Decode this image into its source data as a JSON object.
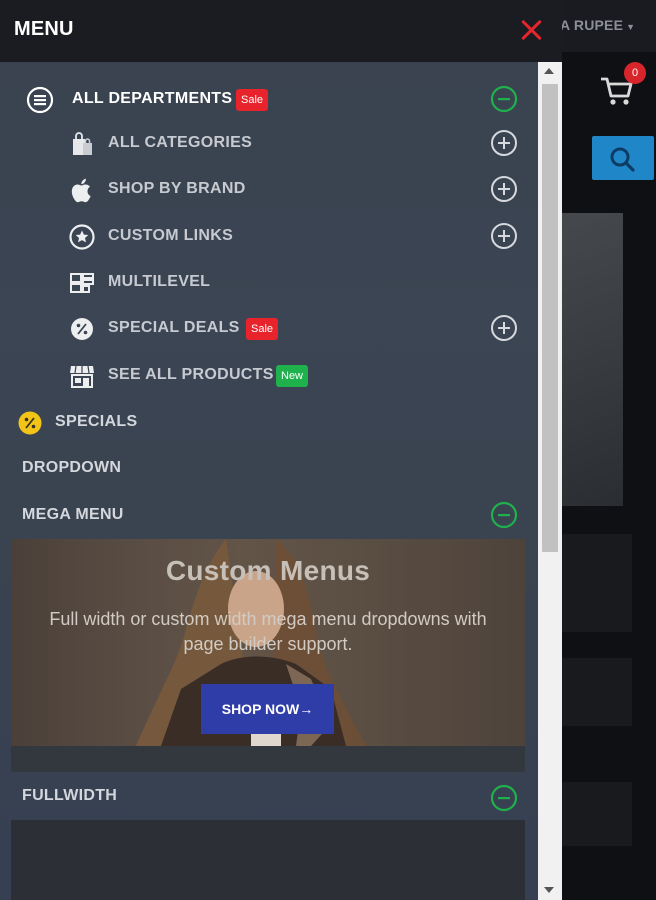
{
  "drawer": {
    "title": "MENU",
    "items": [
      {
        "label": "ALL DEPARTMENTS",
        "badge": "Sale",
        "toggle": "minus"
      },
      {
        "label": "ALL CATEGORIES",
        "toggle": "plus"
      },
      {
        "label": "SHOP BY BRAND",
        "toggle": "plus"
      },
      {
        "label": "CUSTOM LINKS",
        "toggle": "plus"
      },
      {
        "label": "MULTILEVEL"
      },
      {
        "label": "SPECIAL DEALS",
        "badge": "Sale",
        "toggle": "plus"
      },
      {
        "label": "SEE ALL PRODUCTS",
        "badge": "New"
      },
      {
        "label": "SPECIALS"
      },
      {
        "label": "DROPDOWN"
      },
      {
        "label": "MEGA MENU",
        "toggle": "minus"
      },
      {
        "label": "FULLWIDTH",
        "toggle": "minus"
      }
    ],
    "mega_banner": {
      "title": "Custom Menus",
      "text": "Full width or custom width mega menu dropdowns with page builder support.",
      "button": "SHOP NOW→"
    }
  },
  "background": {
    "currency": "A RUPEE",
    "cart_count": "0"
  },
  "icons": [
    "list-circle-icon",
    "shopping-bag-icon",
    "apple-icon",
    "star-circle-icon",
    "grid-layout-icon",
    "percent-badge-icon",
    "store-icon",
    "percent-circle-icon",
    "plus-circle-icon",
    "minus-circle-icon",
    "close-icon",
    "cart-icon",
    "search-icon"
  ],
  "colors": {
    "sale": "#e8232b",
    "new": "#1fb24c",
    "toggle_open": "#1fb24c",
    "close": "#e3262c",
    "header": "#1b1c22",
    "search_button": "#1f86c8",
    "shop_button": "#2f3da8"
  }
}
